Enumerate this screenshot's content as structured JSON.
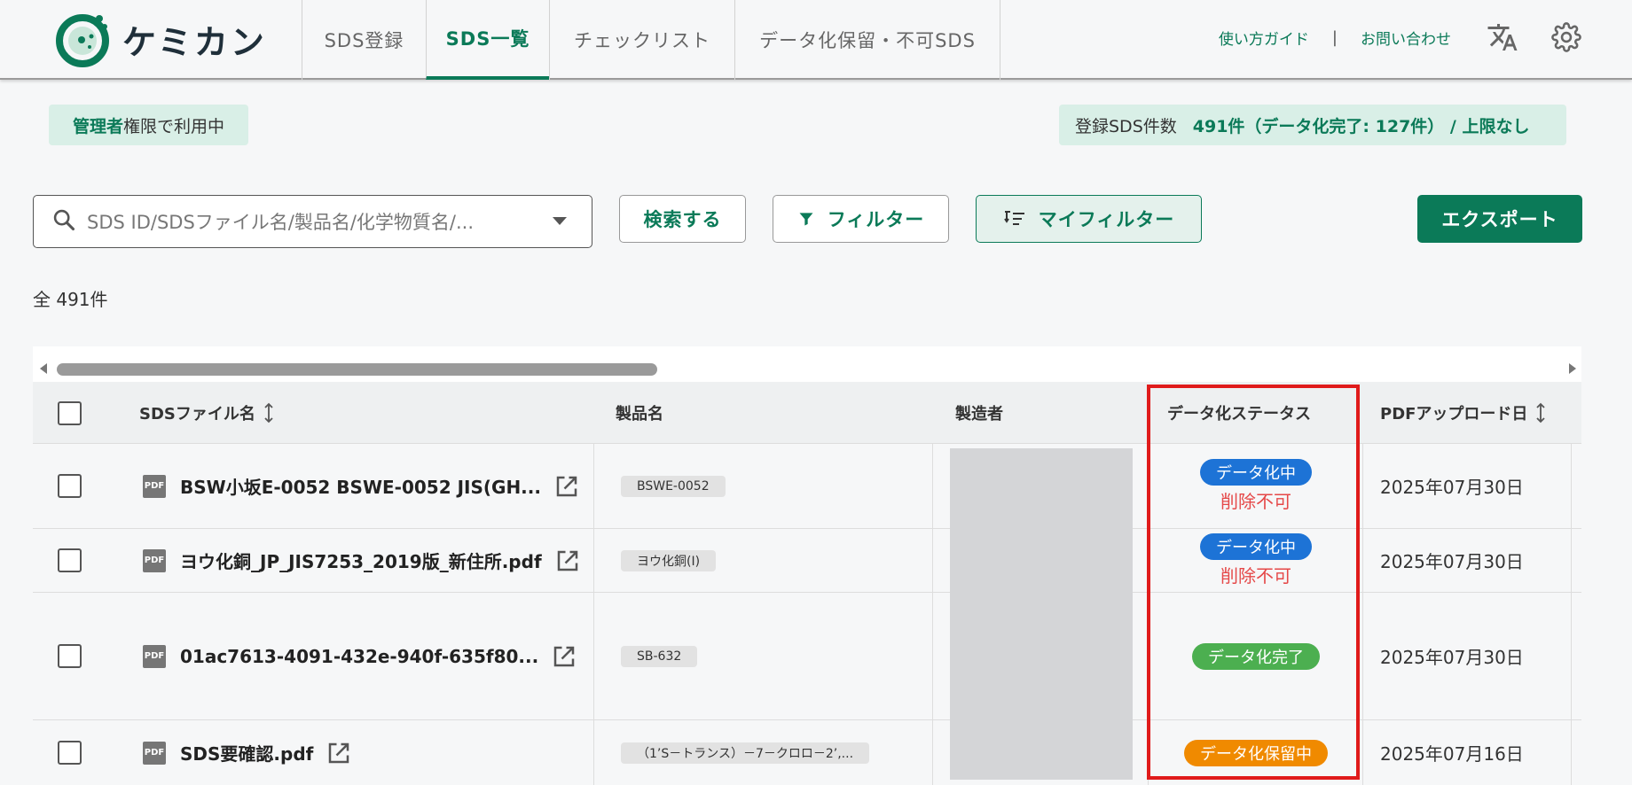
{
  "app": {
    "logo_text": "ケミカン"
  },
  "nav": {
    "tabs": [
      {
        "label": "SDS登録"
      },
      {
        "label": "SDS一覧"
      },
      {
        "label": "チェックリスト"
      },
      {
        "label": "データ化保留・不可SDS"
      }
    ]
  },
  "header": {
    "guide_link": "使い方ガイド",
    "separator": "|",
    "contact_link": "お問い合わせ"
  },
  "role": {
    "bold": "管理者",
    "rest": "権限で利用中"
  },
  "sds_count": {
    "label": "登録SDS件数",
    "value": "491件（データ化完了: 127件） / 上限なし"
  },
  "search": {
    "placeholder": "SDS ID/SDSファイル名/製品名/化学物質名/..."
  },
  "buttons": {
    "search": "検索する",
    "filter": "フィルター",
    "my_filter": "マイフィルター",
    "export": "エクスポート"
  },
  "total": "全 491件",
  "table": {
    "columns": [
      "SDSファイル名",
      "製品名",
      "製造者",
      "データ化ステータス",
      "PDFアップロード日"
    ],
    "pdf_label": "PDF",
    "rows": [
      {
        "file": "BSW小坂E-0052 BSWE-0052 JIS(GH...",
        "product": "BSWE-0052",
        "status": "データ化中",
        "status_color": "#1d73d6",
        "note": "削除不可",
        "date": "2025年07月30日"
      },
      {
        "file": "ヨウ化銅_JP_JIS7253_2019版_新住所.pdf",
        "product": "ヨウ化銅(I)",
        "status": "データ化中",
        "status_color": "#1d73d6",
        "note": "削除不可",
        "date": "2025年07月30日"
      },
      {
        "file": "01ac7613-4091-432e-940f-635f80...",
        "product": "SB-632",
        "status": "データ化完了",
        "status_color": "#4caf50",
        "note": "",
        "date": "2025年07月30日"
      },
      {
        "file": "SDS要確認.pdf",
        "product": "（1’S－トランス）－7－クロロ－2’,...",
        "status": "データ化保留中",
        "status_color": "#f08a00",
        "note": "",
        "date": "2025年07月16日"
      }
    ]
  },
  "colors": {
    "brand": "#0b7a58",
    "highlight": "#e01b1b"
  }
}
